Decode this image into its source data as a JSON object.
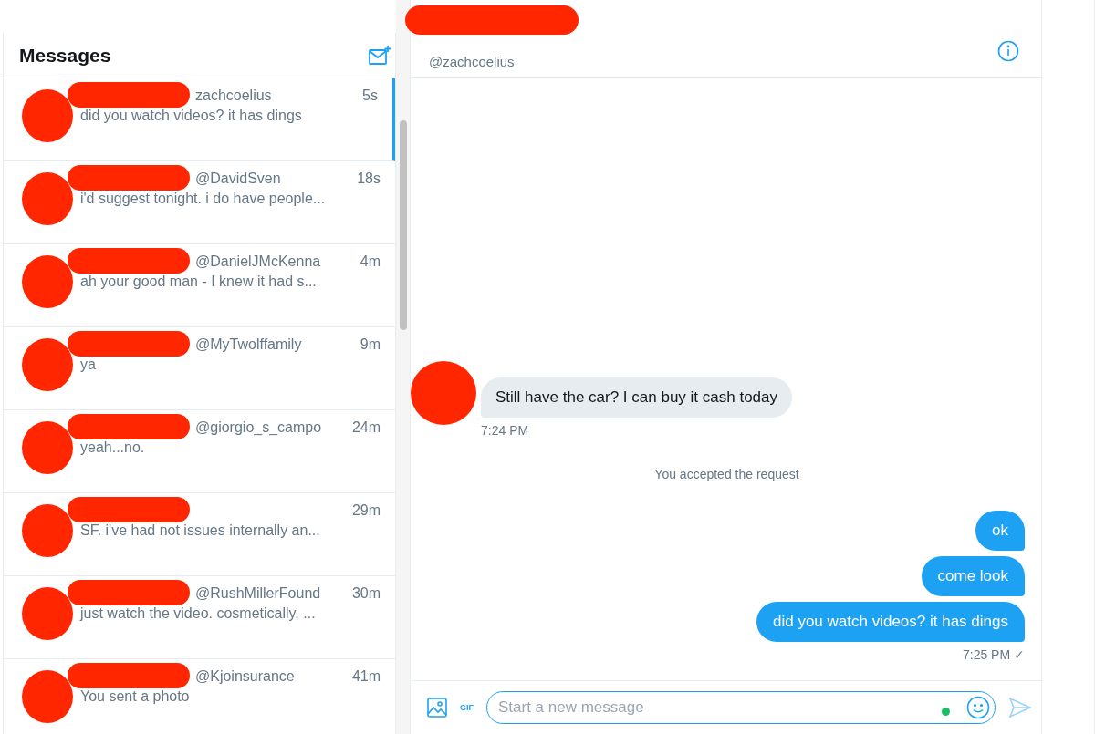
{
  "sidebar": {
    "title": "Messages",
    "conversations": [
      {
        "handle": "zachcoelius",
        "time": "5s",
        "preview": "did you watch videos? it has dings",
        "selected": true
      },
      {
        "handle": "@DavidSven",
        "time": "18s",
        "preview": "i'd suggest tonight. i do have people...",
        "selected": false
      },
      {
        "handle": "@DanielJMcKenna",
        "time": "4m",
        "preview": "ah your good man - I knew it had s...",
        "selected": false
      },
      {
        "handle": "@MyTwolffamily",
        "time": "9m",
        "preview": "ya",
        "selected": false
      },
      {
        "handle": "@giorgio_s_campo",
        "time": "24m",
        "preview": "yeah...no.",
        "selected": false
      },
      {
        "time": "29m",
        "preview": "SF. i've had not issues internally an...",
        "selected": false
      },
      {
        "handle": "@RushMillerFound",
        "time": "30m",
        "preview": "just watch the video. cosmetically, ...",
        "selected": false
      },
      {
        "handle": "@Kjoinsurance",
        "time": "41m",
        "preview": "You sent a photo",
        "selected": false
      }
    ]
  },
  "chat": {
    "handle": "@zachcoelius",
    "messages": [
      {
        "kind": "incoming",
        "text": "Still have the car? I can buy it cash today",
        "time": "7:24 PM"
      },
      {
        "kind": "notice",
        "text": "You accepted the request"
      },
      {
        "kind": "outgoing",
        "text": "ok"
      },
      {
        "kind": "outgoing",
        "text": "come look"
      },
      {
        "kind": "outgoing",
        "text": "did you watch videos? it has dings",
        "time": "7:25 PM ✓"
      }
    ],
    "composer": {
      "placeholder": "Start a new message",
      "gif_label": "GIF"
    }
  }
}
